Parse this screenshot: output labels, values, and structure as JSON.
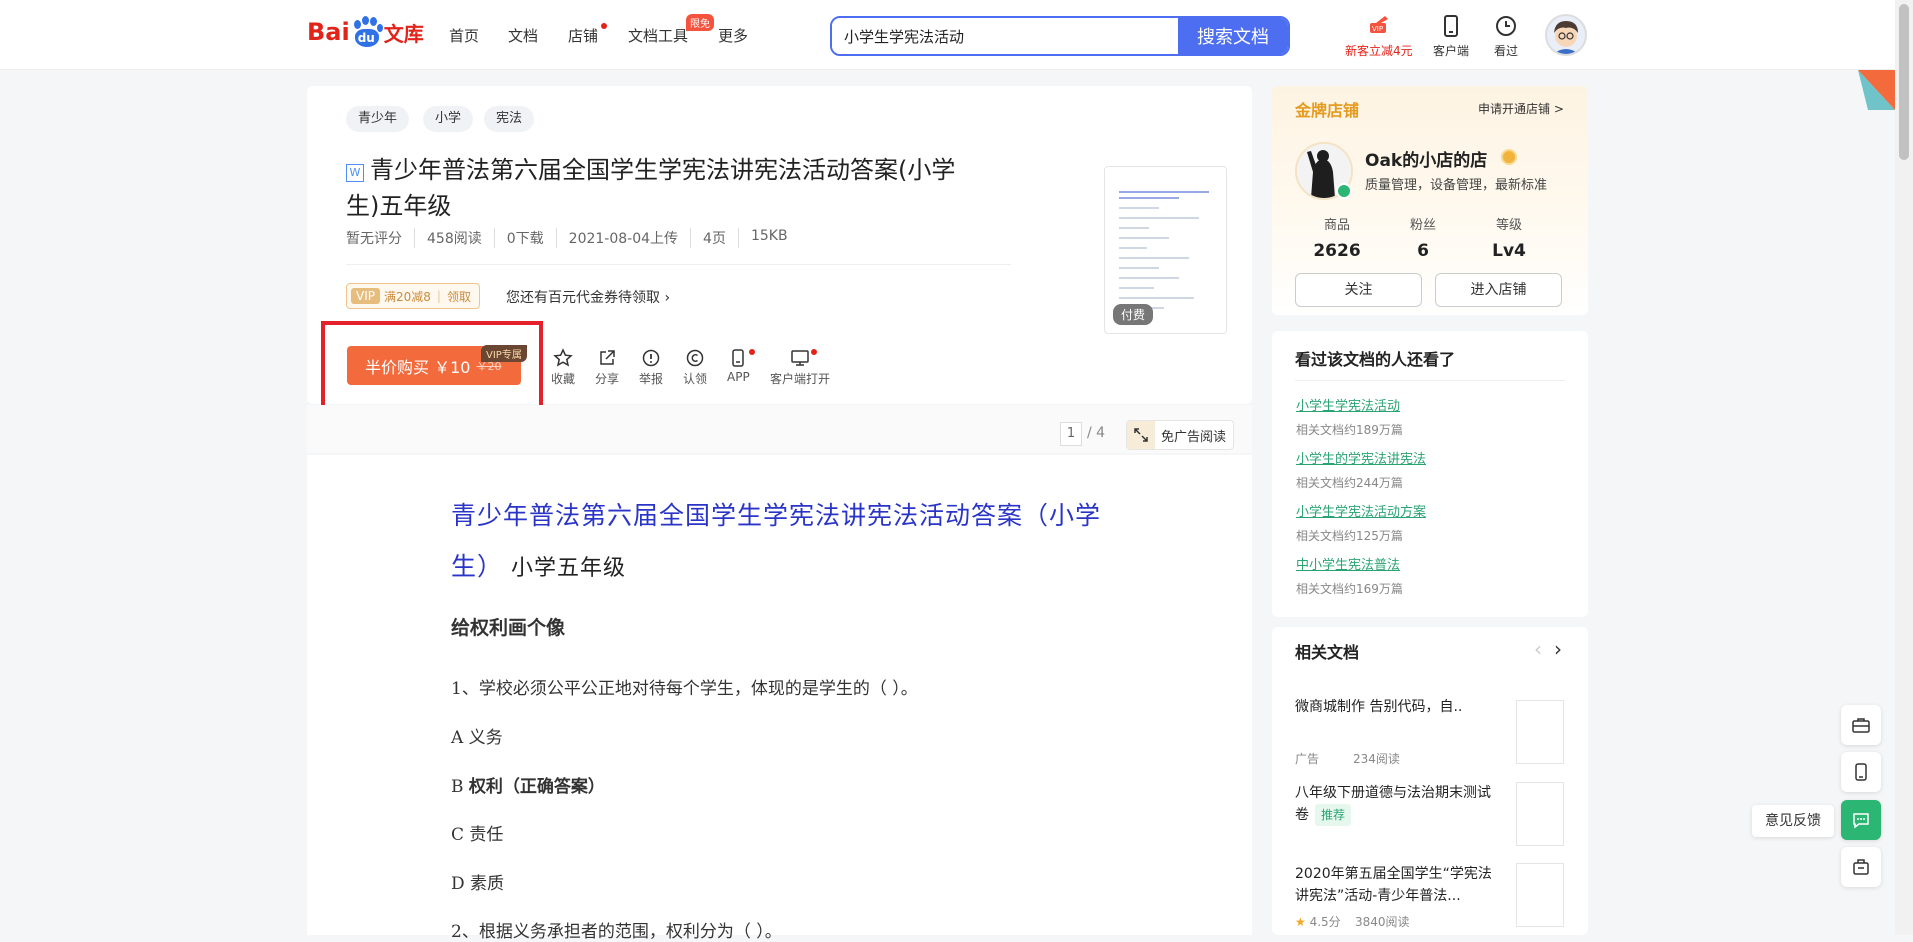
{
  "header": {
    "logo_bai": "Bai",
    "logo_du": "du",
    "logo_wenku": "文库",
    "nav": [
      "首页",
      "文档",
      "店铺",
      "文档工具",
      "更多"
    ],
    "tool_badge": "限免",
    "search_value": "小学生学宪法活动",
    "search_button": "搜索文档",
    "vip_promo": "新客立减4元",
    "client": "客户端",
    "history": "看过"
  },
  "doc": {
    "tags": [
      "青少年",
      "小学",
      "宪法"
    ],
    "type_icon": "W",
    "title": "青少年普法第六届全国学生学宪法讲宪法活动答案(小学生)五年级",
    "meta": [
      "暂无评分",
      "458阅读",
      "0下载",
      "2021-08-04上传",
      "4页",
      "15KB"
    ],
    "coupon_vip": "VIP",
    "coupon_offer": "满20减8",
    "coupon_claim": "领取",
    "coupon_tip": "您还有百元代金券待领取",
    "buy_label": "半价购买 ￥10",
    "buy_old_price": "￥20",
    "vip_exclusive": "VIP专属",
    "actions": [
      "收藏",
      "分享",
      "举报",
      "认领",
      "APP",
      "客户端打开"
    ],
    "paid_badge": "付费",
    "page_current": "1",
    "page_total": "/ 4",
    "no_ad": "免广告阅读"
  },
  "content": {
    "heading_line1": "青少年普法第六届全国学生学宪法讲宪法活动答案（小学",
    "heading_line2_blue": "生）",
    "heading_line2_black": " 小学五年级",
    "section": "给权利画个像",
    "q1": "1、学校必须公平公正地对待每个学生，体现的是学生的（ ）。",
    "a": "A 义务",
    "b_prefix": "B ",
    "b": "权利（正确答案）",
    "c": "C 责任",
    "d": "D 素质",
    "q2": "2、根据义务承担者的范围，权利分为（ ）。"
  },
  "shop": {
    "label": "金牌店铺",
    "apply": "申请开通店铺 >",
    "name": "Oak的小店的店",
    "desc": "质量管理，设备管理，最新标准",
    "stats": [
      {
        "k": "商品",
        "v": "2626"
      },
      {
        "k": "粉丝",
        "v": "6"
      },
      {
        "k": "等级",
        "v": "Lv4"
      }
    ],
    "follow": "关注",
    "enter": "进入店铺"
  },
  "seen": {
    "title": "看过该文档的人还看了",
    "items": [
      {
        "t": "小学生学宪法活动",
        "s": "相关文档约189万篇"
      },
      {
        "t": "小学生的学宪法讲宪法",
        "s": "相关文档约244万篇"
      },
      {
        "t": "小学生学宪法活动方案",
        "s": "相关文档约125万篇"
      },
      {
        "t": "中小学生宪法普法",
        "s": "相关文档约169万篇"
      }
    ]
  },
  "related": {
    "title": "相关文档",
    "items": [
      {
        "t": "微商城制作 告别代码，自..",
        "m1": "广告",
        "m2": "234阅读"
      },
      {
        "t": "八年级下册道德与法治期末测试卷",
        "badge": "推荐"
      },
      {
        "t": "2020年第五届全国学生“学宪法讲宪法”活动-青少年普法...",
        "m1": "4.5分",
        "m2": "3840阅读"
      }
    ]
  },
  "floating": {
    "feedback": "意见反馈"
  },
  "colors": {
    "accent": "#4e6ef2",
    "buy": "#f36a3c",
    "brand_red": "#e2231a",
    "green_link": "#2aa373",
    "gold": "#e59b20"
  }
}
